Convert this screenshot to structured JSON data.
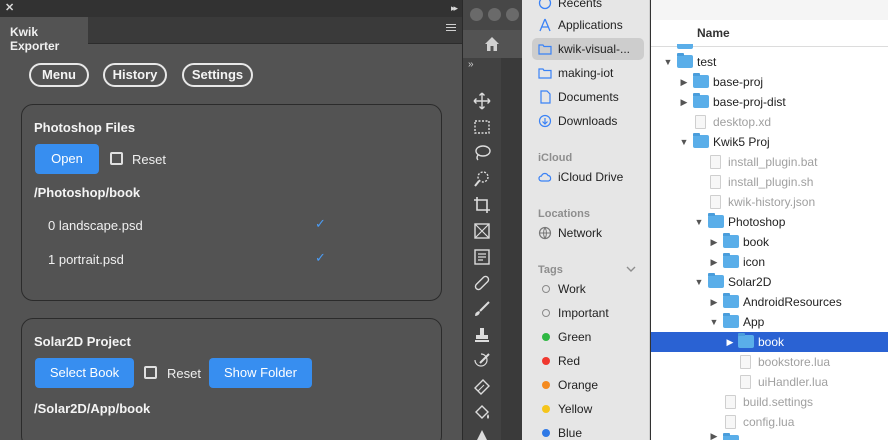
{
  "panel": {
    "title": "Kwik Exporter",
    "nav": [
      "Menu",
      "History",
      "Settings"
    ],
    "photoshop": {
      "title": "Photoshop Files",
      "open_label": "Open",
      "reset_label": "Reset",
      "path": "/Photoshop/book",
      "files": [
        {
          "name": "0 landscape.psd",
          "check": "✓"
        },
        {
          "name": "1 portrait.psd",
          "check": "✓"
        }
      ]
    },
    "solar": {
      "title": "Solar2D Project",
      "select_label": "Select Book",
      "reset_label": "Reset",
      "show_label": "Show Folder",
      "path": "/Solar2D/App/book"
    }
  },
  "finder": {
    "sidebar": {
      "recents": "Recents",
      "applications": "Applications",
      "kwik": "kwik-visual-...",
      "making": "making-iot",
      "documents": "Documents",
      "downloads": "Downloads",
      "icloud_head": "iCloud",
      "icloud_drive": "iCloud Drive",
      "locations_head": "Locations",
      "network": "Network",
      "tags_head": "Tags",
      "tags": [
        {
          "name": "Work",
          "color": "#ffffff"
        },
        {
          "name": "Important",
          "color": "#ffffff"
        },
        {
          "name": "Green",
          "color": "#2fb843"
        },
        {
          "name": "Red",
          "color": "#f0382f"
        },
        {
          "name": "Orange",
          "color": "#f48a1f"
        },
        {
          "name": "Yellow",
          "color": "#f5c51b"
        },
        {
          "name": "Blue",
          "color": "#2f79e6"
        }
      ]
    },
    "list": {
      "column": "Name",
      "rows": [
        "test",
        "base-proj",
        "base-proj-dist",
        "desktop.xd",
        "Kwik5 Proj",
        "install_plugin.bat",
        "install_plugin.sh",
        "kwik-history.json",
        "Photoshop",
        "book",
        "icon",
        "Solar2D",
        "AndroidResources",
        "App",
        "book",
        "bookstore.lua",
        "uiHandler.lua",
        "build.settings",
        "config.lua"
      ]
    }
  },
  "colors": {
    "accent": "#378ef0",
    "selection": "#2a62d3",
    "check": "#4b9cf5"
  }
}
